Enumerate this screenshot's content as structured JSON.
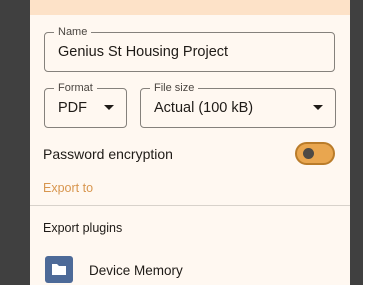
{
  "form": {
    "name_label": "Name",
    "name_value": "Genius St Housing Project",
    "format_label": "Format",
    "format_value": "PDF",
    "size_label": "File size",
    "size_value": "Actual (100 kB)",
    "password_label": "Password encryption",
    "password_enabled": false,
    "export_to_label": "Export to"
  },
  "plugins": {
    "title": "Export plugins",
    "items": [
      {
        "label": "Device Memory",
        "icon": "folder-icon"
      }
    ]
  },
  "colors": {
    "sheet_background": "#fff8f1",
    "header_tint": "#fde2c8",
    "accent": "#d8964f",
    "toggle_track": "#e9a64f",
    "folder_tile": "#4d6a98",
    "scrim": "#404040"
  }
}
